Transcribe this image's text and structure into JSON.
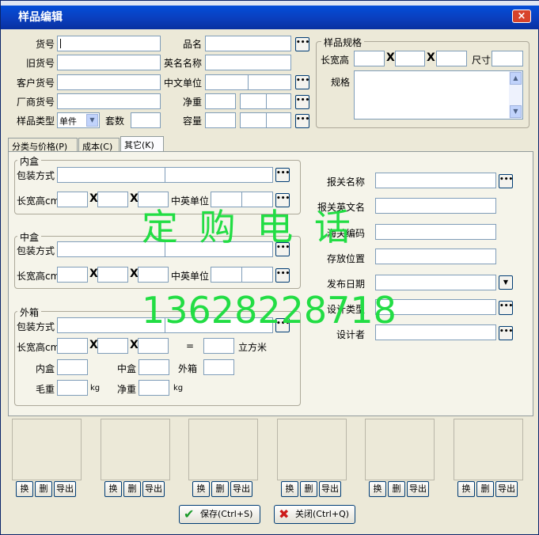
{
  "window": {
    "title": "样品编辑",
    "close_label": "×"
  },
  "fields": {
    "huohao": "货号",
    "pinming": "品名",
    "jiuhuohao": "旧货号",
    "yingwen": "英名名称",
    "kehu": "客户货号",
    "zhongwen_danwei": "中文单位",
    "changshang": "厂商货号",
    "jingzhong": "净重",
    "leixing": "样品类型",
    "leixing_value": "单件",
    "taoshu": "套数",
    "rongliang": "容量"
  },
  "spec": {
    "group": "样品规格",
    "lkg": "长宽高",
    "cun": "尺寸",
    "guige": "规格"
  },
  "tabs": [
    "分类与价格(P)",
    "成本(C)",
    "其它(K)"
  ],
  "inner": {
    "group": "内盒",
    "pack": "包装方式",
    "lwh": "长宽高cm",
    "unit": "中英单位"
  },
  "middle": {
    "group": "中盒",
    "pack": "包装方式",
    "lwh": "长宽高cm",
    "unit": "中英单位"
  },
  "outer": {
    "group": "外箱",
    "pack": "包装方式",
    "lwh": "长宽高cm",
    "eq": "=",
    "cbm": "立方米",
    "neihe": "内盒",
    "zhonghe": "中盒",
    "waixiang": "外箱",
    "gross": "毛重",
    "kg1": "kg",
    "net": "净重",
    "kg2": "kg"
  },
  "right": {
    "baoguan": "报关名称",
    "baoguan_en": "报关英文名",
    "haiguan": "海关编码",
    "cunfang": "存放位置",
    "fabu": "发布日期",
    "sheji_leixing": "设计类型",
    "shejizhe": "设计者"
  },
  "x_mark": "X",
  "image_buttons": {
    "replace": "换",
    "delete": "删",
    "export": "导出"
  },
  "footer": {
    "save": "保存(Ctrl+S)",
    "close": "关闭(Ctrl+Q)"
  },
  "watermark": {
    "line1": "定 购 电 话",
    "line2": "13628228718"
  },
  "colors": {
    "title_bar": "#0a3fbf",
    "panel": "#ece9d8",
    "watermark": "#22dd44",
    "close": "#d8432b"
  }
}
